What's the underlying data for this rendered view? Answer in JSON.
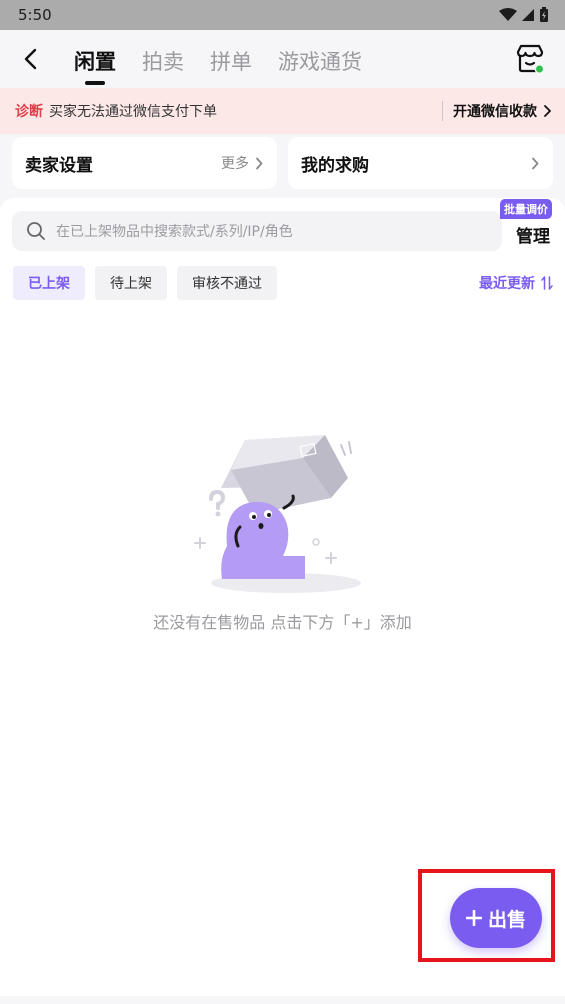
{
  "status_bar": {
    "time": "5:50"
  },
  "nav": {
    "tabs": [
      {
        "label": "闲置",
        "active": true
      },
      {
        "label": "拍卖",
        "active": false
      },
      {
        "label": "拼单",
        "active": false
      },
      {
        "label": "游戏通货",
        "active": false
      }
    ]
  },
  "diagnosis": {
    "tag": "诊断",
    "message": "买家无法通过微信支付下单",
    "action": "开通微信收款"
  },
  "cards": {
    "seller_settings": {
      "title": "卖家设置",
      "more": "更多"
    },
    "my_requests": {
      "title": "我的求购"
    }
  },
  "search": {
    "placeholder": "在已上架物品中搜索款式/系列/IP/角色"
  },
  "manage": {
    "label": "管理",
    "badge": "批量调价"
  },
  "filters": [
    {
      "label": "已上架",
      "active": true
    },
    {
      "label": "待上架",
      "active": false
    },
    {
      "label": "审核不通过",
      "active": false
    }
  ],
  "sort": {
    "label": "最近更新"
  },
  "empty_state": {
    "message": "还没有在售物品 点击下方「+」添加"
  },
  "fab": {
    "label": "出售"
  },
  "colors": {
    "accent": "#7b5cf0",
    "diagnosis_tag": "#e0404b",
    "highlight_frame": "#e8141c"
  }
}
